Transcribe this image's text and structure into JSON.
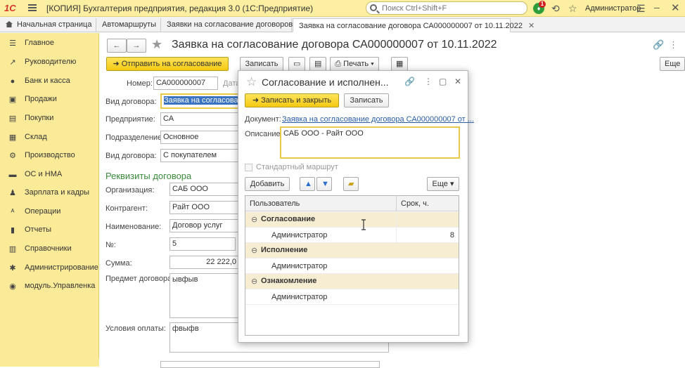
{
  "titlebar": {
    "logo": "1С",
    "title": "[КОПИЯ] Бухгалтерия предприятия, редакция 3.0  (1С:Предприятие)",
    "search_placeholder": "Поиск Ctrl+Shift+F",
    "notification_count": "1",
    "user": "Администратор"
  },
  "tabs": [
    {
      "label": "Начальная страница"
    },
    {
      "label": "Автомаршруты"
    },
    {
      "label": "Заявки на согласование договоров"
    },
    {
      "label": "Заявка на согласование договора СА000000007 от 10.11.2022"
    }
  ],
  "sidebar": {
    "items": [
      {
        "label": "Главное",
        "icon": "menu-icon"
      },
      {
        "label": "Руководителю",
        "icon": "chart-icon"
      },
      {
        "label": "Банк и касса",
        "icon": "bank-icon"
      },
      {
        "label": "Продажи",
        "icon": "sales-icon"
      },
      {
        "label": "Покупки",
        "icon": "cart-icon"
      },
      {
        "label": "Склад",
        "icon": "warehouse-icon"
      },
      {
        "label": "Производство",
        "icon": "factory-icon"
      },
      {
        "label": "ОС и НМА",
        "icon": "assets-icon"
      },
      {
        "label": "Зарплата и кадры",
        "icon": "people-icon"
      },
      {
        "label": "Операции",
        "icon": "operations-icon"
      },
      {
        "label": "Отчеты",
        "icon": "reports-icon"
      },
      {
        "label": "Справочники",
        "icon": "books-icon"
      },
      {
        "label": "Администрирование",
        "icon": "gear-icon"
      },
      {
        "label": "модуль.Управленка",
        "icon": "module-icon"
      }
    ]
  },
  "form": {
    "title": "Заявка на согласование договора СА000000007 от 10.11.2022",
    "send_button": "Отправить на согласование",
    "save_button": "Записать",
    "print_button": "Печать",
    "more_button": "Еще",
    "number_label": "Номер:",
    "number_value": "СА000000007",
    "date_label": "Дата",
    "fields": {
      "contract_kind_label": "Вид договора:",
      "contract_kind_value": "Заявка на согласование",
      "enterprise_label": "Предприятие:",
      "enterprise_value": "СА",
      "division_label": "Подразделение:",
      "division_value": "Основное",
      "contract_type_label": "Вид договора:",
      "contract_type_value": "С покупателем"
    },
    "section_title": "Реквизиты договора",
    "requisites": {
      "org_label": "Организация:",
      "org_value": "САБ ООО",
      "contractor_label": "Контрагент:",
      "contractor_value": "Райт ООО",
      "name_label": "Наименование:",
      "name_value": "Договор услуг",
      "number_label": "№:",
      "number_value": "5",
      "sum_label": "Сумма:",
      "sum_value": "22 222,0",
      "subject_label": "Предмет договора:",
      "subject_value": "ывфыв",
      "payment_label": "Условия оплаты:",
      "payment_value": "фвыфв"
    }
  },
  "dialog": {
    "title": "Согласование и исполнен...",
    "save_close_button": "Записать и закрыть",
    "save_button": "Записать",
    "document_label": "Документ:",
    "document_link": "Заявка на согласование договора СА000000007 от ...",
    "description_label": "Описание:",
    "description_value": "САБ ООО - Райт ООО",
    "standard_route_label": "Стандартный маршрут",
    "add_button": "Добавить",
    "more_button": "Еще",
    "grid": {
      "col_user": "Пользователь",
      "col_term": "Срок, ч.",
      "groups": [
        {
          "name": "Согласование",
          "rows": [
            {
              "user": "Администратор",
              "hours": "8"
            }
          ]
        },
        {
          "name": "Исполнение",
          "rows": [
            {
              "user": "Администратор",
              "hours": ""
            }
          ]
        },
        {
          "name": "Ознакомление",
          "rows": [
            {
              "user": "Администратор",
              "hours": ""
            }
          ]
        }
      ]
    }
  }
}
